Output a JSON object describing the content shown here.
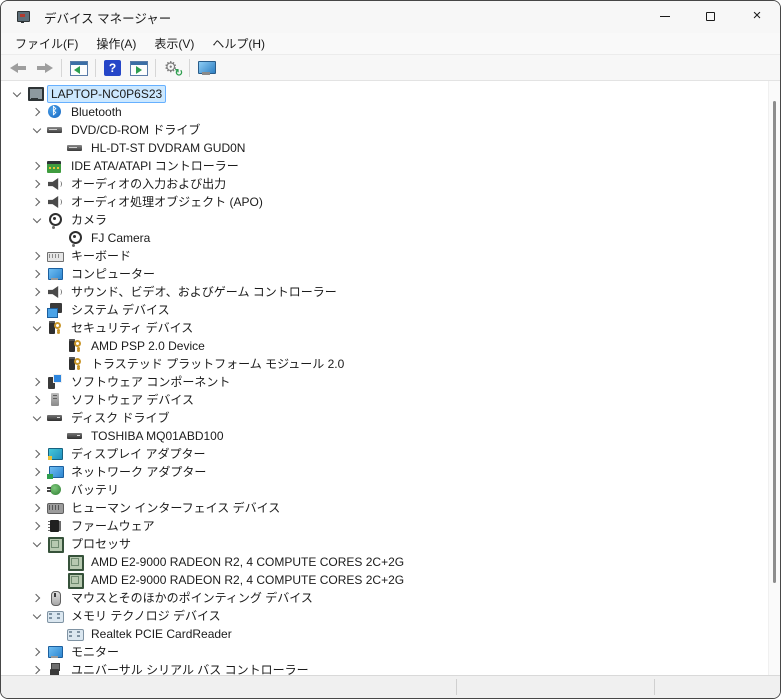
{
  "window": {
    "title": "デバイス マネージャー",
    "app_icon": "device-manager-icon",
    "controls": [
      {
        "name": "minimize"
      },
      {
        "name": "maximize"
      },
      {
        "name": "close"
      }
    ]
  },
  "menu": {
    "items": [
      {
        "label": "ファイル(F)"
      },
      {
        "label": "操作(A)"
      },
      {
        "label": "表示(V)"
      },
      {
        "label": "ヘルプ(H)"
      }
    ]
  },
  "toolbar": {
    "buttons": [
      {
        "name": "back",
        "icon": "back-arrow-icon",
        "enabled": false
      },
      {
        "name": "forward",
        "icon": "forward-arrow-icon",
        "enabled": false
      },
      {
        "name": "separator"
      },
      {
        "name": "show-console-tree",
        "icon": "console-tree-window-icon",
        "enabled": true
      },
      {
        "name": "separator"
      },
      {
        "name": "help",
        "icon": "help-question-icon",
        "enabled": true
      },
      {
        "name": "properties",
        "icon": "window-play-icon",
        "enabled": true
      },
      {
        "name": "separator"
      },
      {
        "name": "scan-hardware-changes",
        "icon": "gear-refresh-icon",
        "enabled": true
      },
      {
        "name": "separator"
      },
      {
        "name": "devices-view",
        "icon": "computer-monitor-icon",
        "enabled": true
      }
    ]
  },
  "tree": {
    "nodes": [
      {
        "label": "LAPTOP-NC0P6S23",
        "depth": 0,
        "state": "expanded",
        "icon": "computer-icon",
        "selected": true
      },
      {
        "label": "Bluetooth",
        "depth": 1,
        "state": "collapsed",
        "icon": "bluetooth-icon",
        "selected": false
      },
      {
        "label": "DVD/CD-ROM ドライブ",
        "depth": 1,
        "state": "expanded",
        "icon": "optical-drive-icon",
        "selected": false
      },
      {
        "label": "HL-DT-ST DVDRAM GUD0N",
        "depth": 2,
        "state": "none",
        "icon": "optical-drive-icon",
        "selected": false
      },
      {
        "label": "IDE ATA/ATAPI コントローラー",
        "depth": 1,
        "state": "collapsed",
        "icon": "storage-controller-icon",
        "selected": false
      },
      {
        "label": "オーディオの入力および出力",
        "depth": 1,
        "state": "collapsed",
        "icon": "speaker-icon",
        "selected": false
      },
      {
        "label": "オーディオ処理オブジェクト (APO)",
        "depth": 1,
        "state": "collapsed",
        "icon": "speaker-icon",
        "selected": false
      },
      {
        "label": "カメラ",
        "depth": 1,
        "state": "expanded",
        "icon": "camera-icon",
        "selected": false
      },
      {
        "label": "FJ Camera",
        "depth": 2,
        "state": "none",
        "icon": "camera-icon",
        "selected": false
      },
      {
        "label": "キーボード",
        "depth": 1,
        "state": "collapsed",
        "icon": "keyboard-icon",
        "selected": false
      },
      {
        "label": "コンピューター",
        "depth": 1,
        "state": "collapsed",
        "icon": "monitor-icon",
        "selected": false
      },
      {
        "label": "サウンド、ビデオ、およびゲーム コントローラー",
        "depth": 1,
        "state": "collapsed",
        "icon": "speaker-icon",
        "selected": false
      },
      {
        "label": "システム デバイス",
        "depth": 1,
        "state": "collapsed",
        "icon": "system-devices-icon",
        "selected": false
      },
      {
        "label": "セキュリティ デバイス",
        "depth": 1,
        "state": "expanded",
        "icon": "security-device-icon",
        "selected": false
      },
      {
        "label": "AMD PSP 2.0 Device",
        "depth": 2,
        "state": "none",
        "icon": "security-device-icon",
        "selected": false
      },
      {
        "label": "トラステッド プラットフォーム モジュール 2.0",
        "depth": 2,
        "state": "none",
        "icon": "security-device-icon",
        "selected": false
      },
      {
        "label": "ソフトウェア コンポーネント",
        "depth": 1,
        "state": "collapsed",
        "icon": "software-component-icon",
        "selected": false
      },
      {
        "label": "ソフトウェア デバイス",
        "depth": 1,
        "state": "collapsed",
        "icon": "software-device-icon",
        "selected": false
      },
      {
        "label": "ディスク ドライブ",
        "depth": 1,
        "state": "expanded",
        "icon": "disk-drive-icon",
        "selected": false
      },
      {
        "label": "TOSHIBA MQ01ABD100",
        "depth": 2,
        "state": "none",
        "icon": "disk-drive-icon",
        "selected": false
      },
      {
        "label": "ディスプレイ アダプター",
        "depth": 1,
        "state": "collapsed",
        "icon": "display-adapter-icon",
        "selected": false
      },
      {
        "label": "ネットワーク アダプター",
        "depth": 1,
        "state": "collapsed",
        "icon": "network-adapter-icon",
        "selected": false
      },
      {
        "label": "バッテリ",
        "depth": 1,
        "state": "collapsed",
        "icon": "battery-icon",
        "selected": false
      },
      {
        "label": "ヒューマン インターフェイス デバイス",
        "depth": 1,
        "state": "collapsed",
        "icon": "hid-icon",
        "selected": false
      },
      {
        "label": "ファームウェア",
        "depth": 1,
        "state": "collapsed",
        "icon": "firmware-icon",
        "selected": false
      },
      {
        "label": "プロセッサ",
        "depth": 1,
        "state": "expanded",
        "icon": "processor-icon",
        "selected": false
      },
      {
        "label": "AMD E2-9000 RADEON R2, 4 COMPUTE CORES 2C+2G",
        "depth": 2,
        "state": "none",
        "icon": "processor-icon",
        "selected": false
      },
      {
        "label": "AMD E2-9000 RADEON R2, 4 COMPUTE CORES 2C+2G",
        "depth": 2,
        "state": "none",
        "icon": "processor-icon",
        "selected": false
      },
      {
        "label": "マウスとそのほかのポインティング デバイス",
        "depth": 1,
        "state": "collapsed",
        "icon": "mouse-icon",
        "selected": false
      },
      {
        "label": "メモリ テクノロジ デバイス",
        "depth": 1,
        "state": "expanded",
        "icon": "memory-card-icon",
        "selected": false
      },
      {
        "label": "Realtek PCIE CardReader",
        "depth": 2,
        "state": "none",
        "icon": "memory-card-icon",
        "selected": false
      },
      {
        "label": "モニター",
        "depth": 1,
        "state": "collapsed",
        "icon": "monitor-icon",
        "selected": false
      },
      {
        "label": "ユニバーサル シリアル バス コントローラー",
        "depth": 1,
        "state": "collapsed",
        "icon": "usb-icon",
        "selected": false
      }
    ]
  },
  "status_bar": {
    "panes": [
      "",
      "",
      ""
    ]
  },
  "colors": {
    "selection_bg": "#cce8ff",
    "selection_border": "#66b0ff",
    "chrome_bg": "#f7f7f7",
    "tree_bg": "#ffffff",
    "status_bg": "#f0f0f0",
    "help_icon_bg": "#2646c8",
    "green_accent": "#2e9e4f"
  }
}
